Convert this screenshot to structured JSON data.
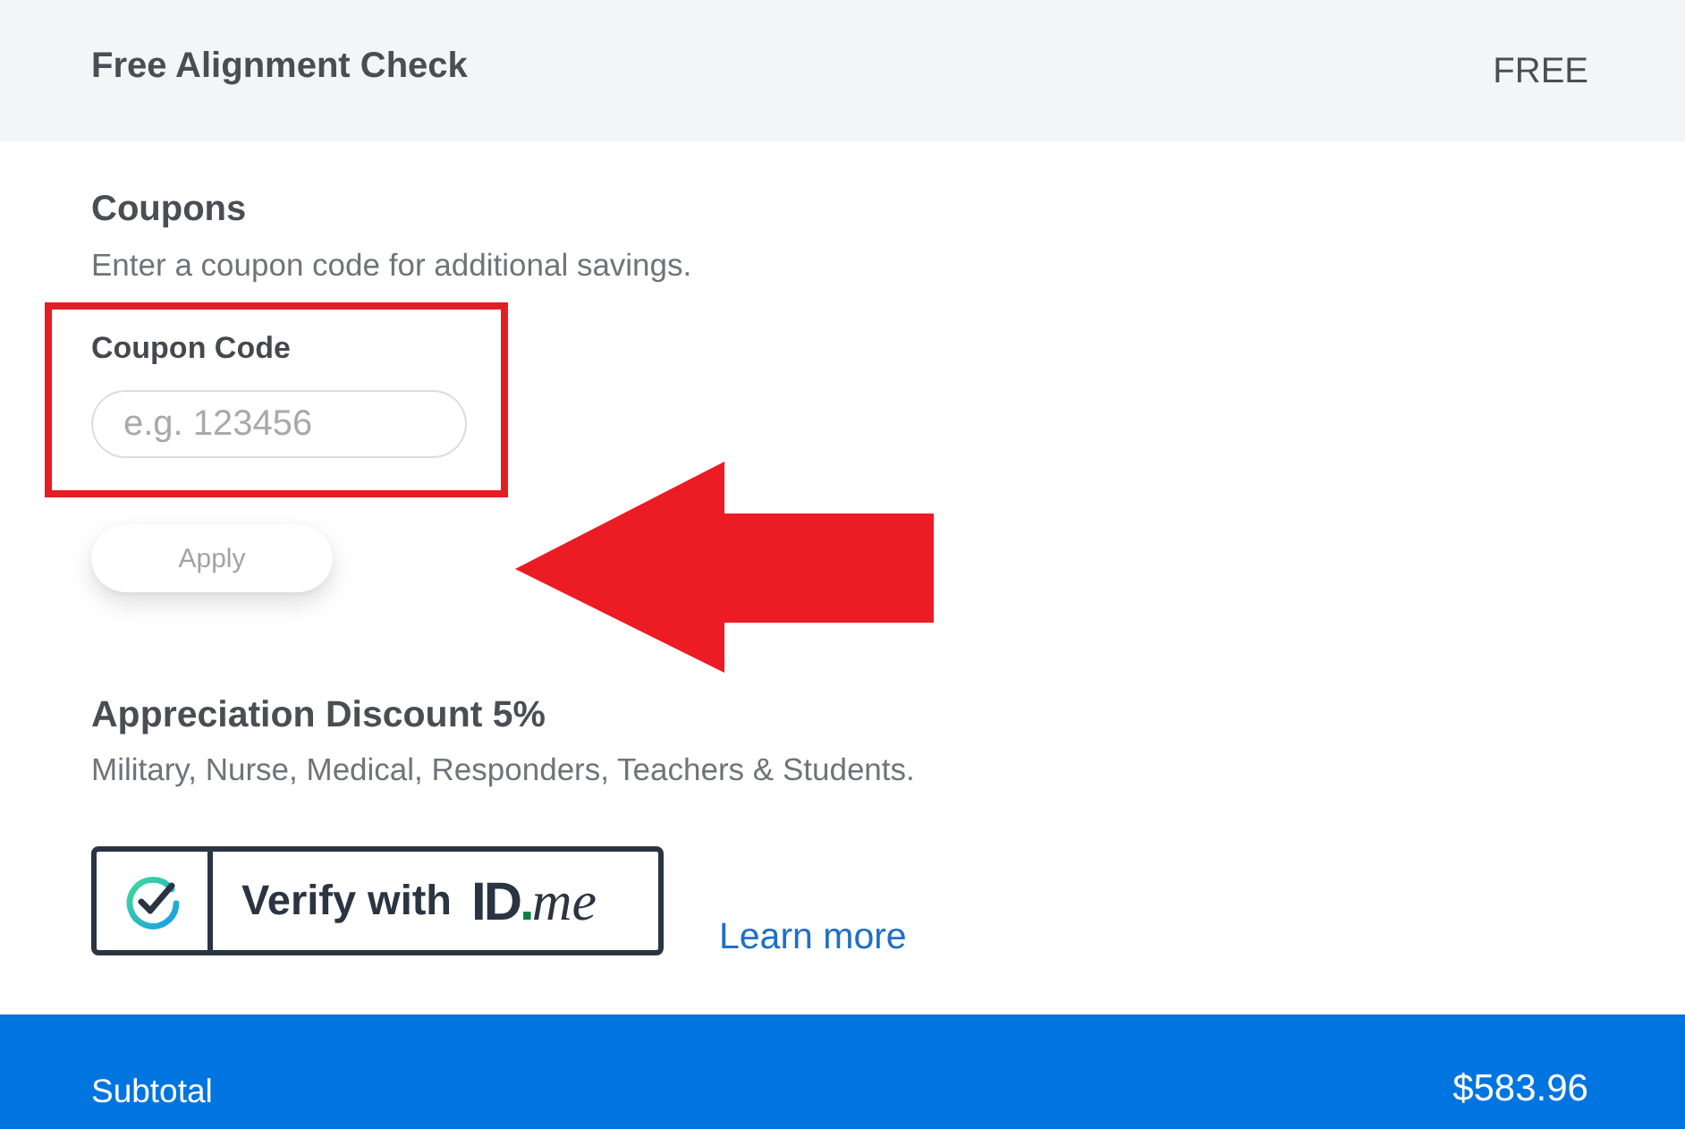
{
  "line_item": {
    "name": "Free Alignment Check",
    "price": "FREE"
  },
  "coupons": {
    "title": "Coupons",
    "description": "Enter a coupon code for additional savings.",
    "field": {
      "label": "Coupon Code",
      "placeholder": "e.g. 123456",
      "highlighted": true
    },
    "apply_button": {
      "label": "Apply",
      "disabled": true
    },
    "pointer_arrow": true
  },
  "discount": {
    "title": "Appreciation Discount 5%",
    "description": "Military, Nurse, Medical, Responders, Teachers & Students.",
    "verify_button": {
      "label": "Verify with",
      "logo": {
        "mark": "ID",
        "dot": ".",
        "suffix": "me"
      }
    },
    "link": "Learn more"
  },
  "subtotal": {
    "label": "Subtotal",
    "amount": "$583.96"
  }
}
